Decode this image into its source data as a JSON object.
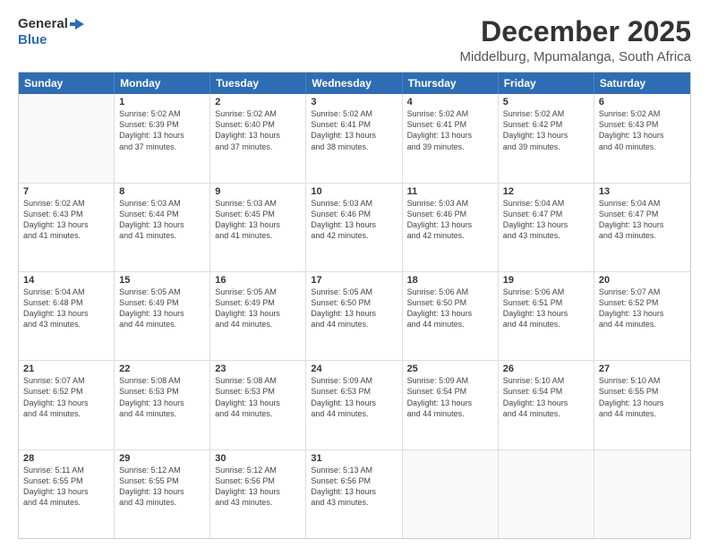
{
  "logo": {
    "line1": "General",
    "line2": "Blue"
  },
  "title": "December 2025",
  "subtitle": "Middelburg, Mpumalanga, South Africa",
  "header_days": [
    "Sunday",
    "Monday",
    "Tuesday",
    "Wednesday",
    "Thursday",
    "Friday",
    "Saturday"
  ],
  "weeks": [
    [
      {
        "day": "",
        "info": ""
      },
      {
        "day": "1",
        "info": "Sunrise: 5:02 AM\nSunset: 6:39 PM\nDaylight: 13 hours\nand 37 minutes."
      },
      {
        "day": "2",
        "info": "Sunrise: 5:02 AM\nSunset: 6:40 PM\nDaylight: 13 hours\nand 37 minutes."
      },
      {
        "day": "3",
        "info": "Sunrise: 5:02 AM\nSunset: 6:41 PM\nDaylight: 13 hours\nand 38 minutes."
      },
      {
        "day": "4",
        "info": "Sunrise: 5:02 AM\nSunset: 6:41 PM\nDaylight: 13 hours\nand 39 minutes."
      },
      {
        "day": "5",
        "info": "Sunrise: 5:02 AM\nSunset: 6:42 PM\nDaylight: 13 hours\nand 39 minutes."
      },
      {
        "day": "6",
        "info": "Sunrise: 5:02 AM\nSunset: 6:43 PM\nDaylight: 13 hours\nand 40 minutes."
      }
    ],
    [
      {
        "day": "7",
        "info": "Sunrise: 5:02 AM\nSunset: 6:43 PM\nDaylight: 13 hours\nand 41 minutes."
      },
      {
        "day": "8",
        "info": "Sunrise: 5:03 AM\nSunset: 6:44 PM\nDaylight: 13 hours\nand 41 minutes."
      },
      {
        "day": "9",
        "info": "Sunrise: 5:03 AM\nSunset: 6:45 PM\nDaylight: 13 hours\nand 41 minutes."
      },
      {
        "day": "10",
        "info": "Sunrise: 5:03 AM\nSunset: 6:46 PM\nDaylight: 13 hours\nand 42 minutes."
      },
      {
        "day": "11",
        "info": "Sunrise: 5:03 AM\nSunset: 6:46 PM\nDaylight: 13 hours\nand 42 minutes."
      },
      {
        "day": "12",
        "info": "Sunrise: 5:04 AM\nSunset: 6:47 PM\nDaylight: 13 hours\nand 43 minutes."
      },
      {
        "day": "13",
        "info": "Sunrise: 5:04 AM\nSunset: 6:47 PM\nDaylight: 13 hours\nand 43 minutes."
      }
    ],
    [
      {
        "day": "14",
        "info": "Sunrise: 5:04 AM\nSunset: 6:48 PM\nDaylight: 13 hours\nand 43 minutes."
      },
      {
        "day": "15",
        "info": "Sunrise: 5:05 AM\nSunset: 6:49 PM\nDaylight: 13 hours\nand 44 minutes."
      },
      {
        "day": "16",
        "info": "Sunrise: 5:05 AM\nSunset: 6:49 PM\nDaylight: 13 hours\nand 44 minutes."
      },
      {
        "day": "17",
        "info": "Sunrise: 5:05 AM\nSunset: 6:50 PM\nDaylight: 13 hours\nand 44 minutes."
      },
      {
        "day": "18",
        "info": "Sunrise: 5:06 AM\nSunset: 6:50 PM\nDaylight: 13 hours\nand 44 minutes."
      },
      {
        "day": "19",
        "info": "Sunrise: 5:06 AM\nSunset: 6:51 PM\nDaylight: 13 hours\nand 44 minutes."
      },
      {
        "day": "20",
        "info": "Sunrise: 5:07 AM\nSunset: 6:52 PM\nDaylight: 13 hours\nand 44 minutes."
      }
    ],
    [
      {
        "day": "21",
        "info": "Sunrise: 5:07 AM\nSunset: 6:52 PM\nDaylight: 13 hours\nand 44 minutes."
      },
      {
        "day": "22",
        "info": "Sunrise: 5:08 AM\nSunset: 6:53 PM\nDaylight: 13 hours\nand 44 minutes."
      },
      {
        "day": "23",
        "info": "Sunrise: 5:08 AM\nSunset: 6:53 PM\nDaylight: 13 hours\nand 44 minutes."
      },
      {
        "day": "24",
        "info": "Sunrise: 5:09 AM\nSunset: 6:53 PM\nDaylight: 13 hours\nand 44 minutes."
      },
      {
        "day": "25",
        "info": "Sunrise: 5:09 AM\nSunset: 6:54 PM\nDaylight: 13 hours\nand 44 minutes."
      },
      {
        "day": "26",
        "info": "Sunrise: 5:10 AM\nSunset: 6:54 PM\nDaylight: 13 hours\nand 44 minutes."
      },
      {
        "day": "27",
        "info": "Sunrise: 5:10 AM\nSunset: 6:55 PM\nDaylight: 13 hours\nand 44 minutes."
      }
    ],
    [
      {
        "day": "28",
        "info": "Sunrise: 5:11 AM\nSunset: 6:55 PM\nDaylight: 13 hours\nand 44 minutes."
      },
      {
        "day": "29",
        "info": "Sunrise: 5:12 AM\nSunset: 6:55 PM\nDaylight: 13 hours\nand 43 minutes."
      },
      {
        "day": "30",
        "info": "Sunrise: 5:12 AM\nSunset: 6:56 PM\nDaylight: 13 hours\nand 43 minutes."
      },
      {
        "day": "31",
        "info": "Sunrise: 5:13 AM\nSunset: 6:56 PM\nDaylight: 13 hours\nand 43 minutes."
      },
      {
        "day": "",
        "info": ""
      },
      {
        "day": "",
        "info": ""
      },
      {
        "day": "",
        "info": ""
      }
    ]
  ]
}
